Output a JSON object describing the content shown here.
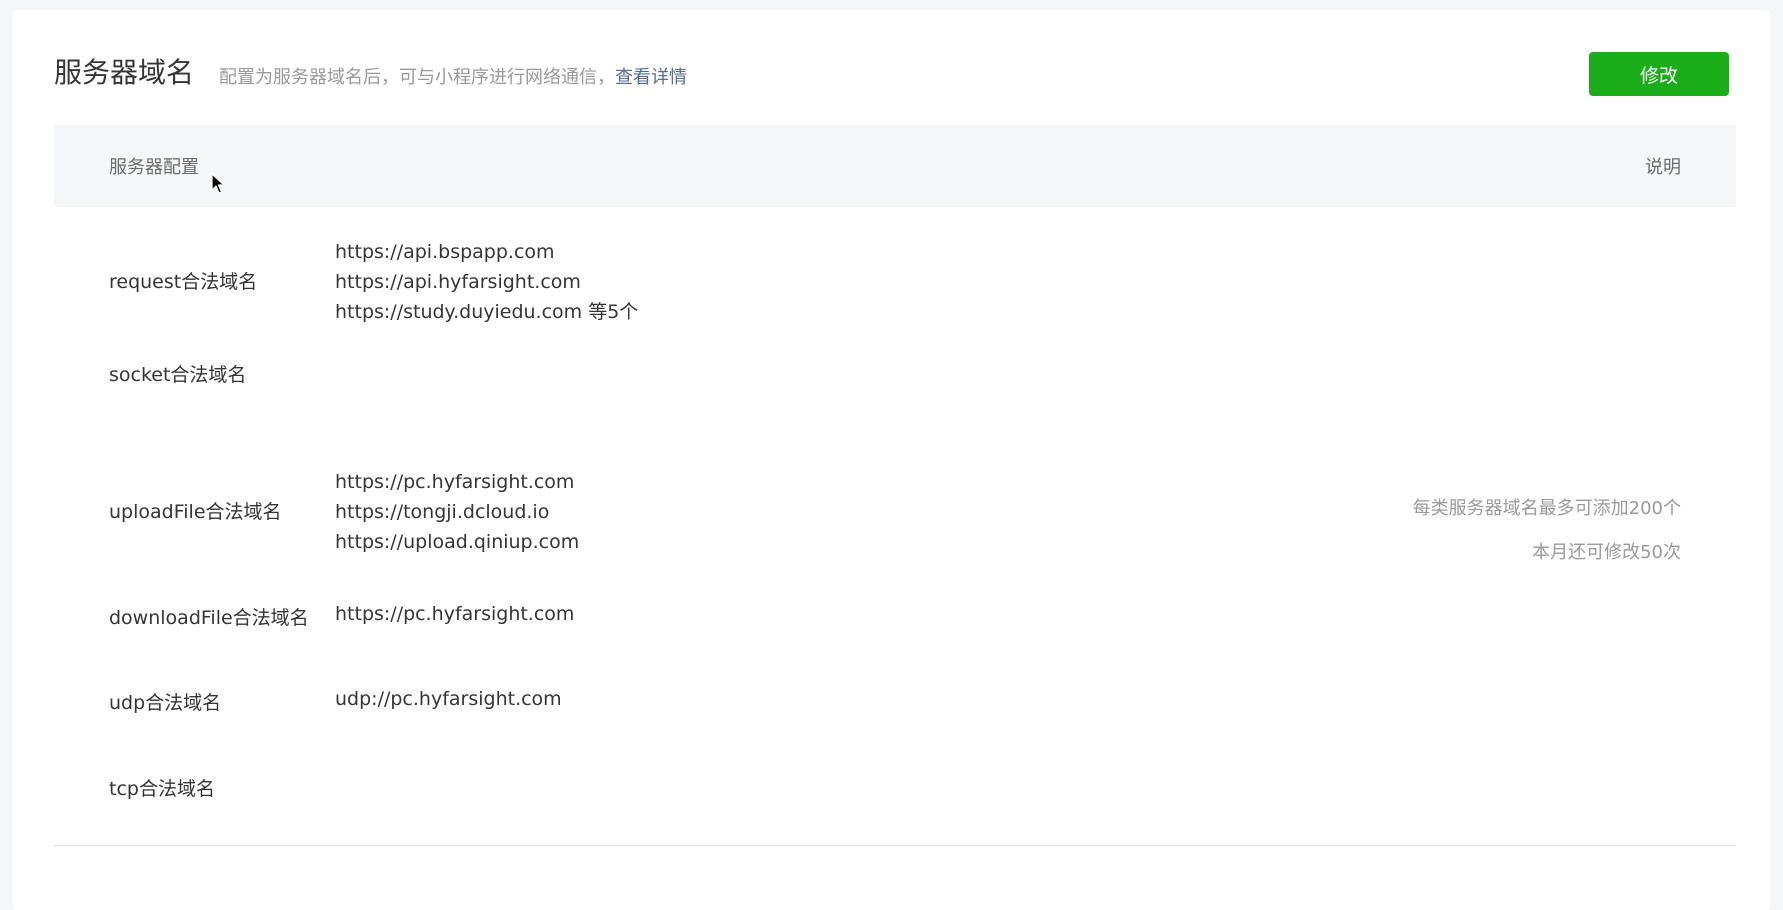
{
  "header": {
    "title": "服务器域名",
    "subtitle": "配置为服务器域名后，可与小程序进行网络通信，",
    "detail_link": "查看详情",
    "edit_button": "修改"
  },
  "table": {
    "columns": {
      "config": "服务器配置",
      "note": "说明"
    },
    "rows": [
      {
        "label": "request合法域名",
        "values": [
          "https://api.bspapp.com",
          "https://api.hyfarsight.com",
          "https://study.duyiedu.com 等5个"
        ]
      },
      {
        "label": "socket合法域名",
        "values": []
      },
      {
        "label": "uploadFile合法域名",
        "values": [
          "https://pc.hyfarsight.com",
          "https://tongji.dcloud.io",
          "https://upload.qiniup.com"
        ]
      },
      {
        "label": "downloadFile合法域名",
        "values": [
          "https://pc.hyfarsight.com"
        ]
      },
      {
        "label": "udp合法域名",
        "values": [
          "udp://pc.hyfarsight.com"
        ]
      },
      {
        "label": "tcp合法域名",
        "values": []
      }
    ],
    "notes": [
      "每类服务器域名最多可添加200个",
      "本月还可修改50次"
    ]
  },
  "icons": {
    "cursor": "mouse-pointer-icon"
  }
}
